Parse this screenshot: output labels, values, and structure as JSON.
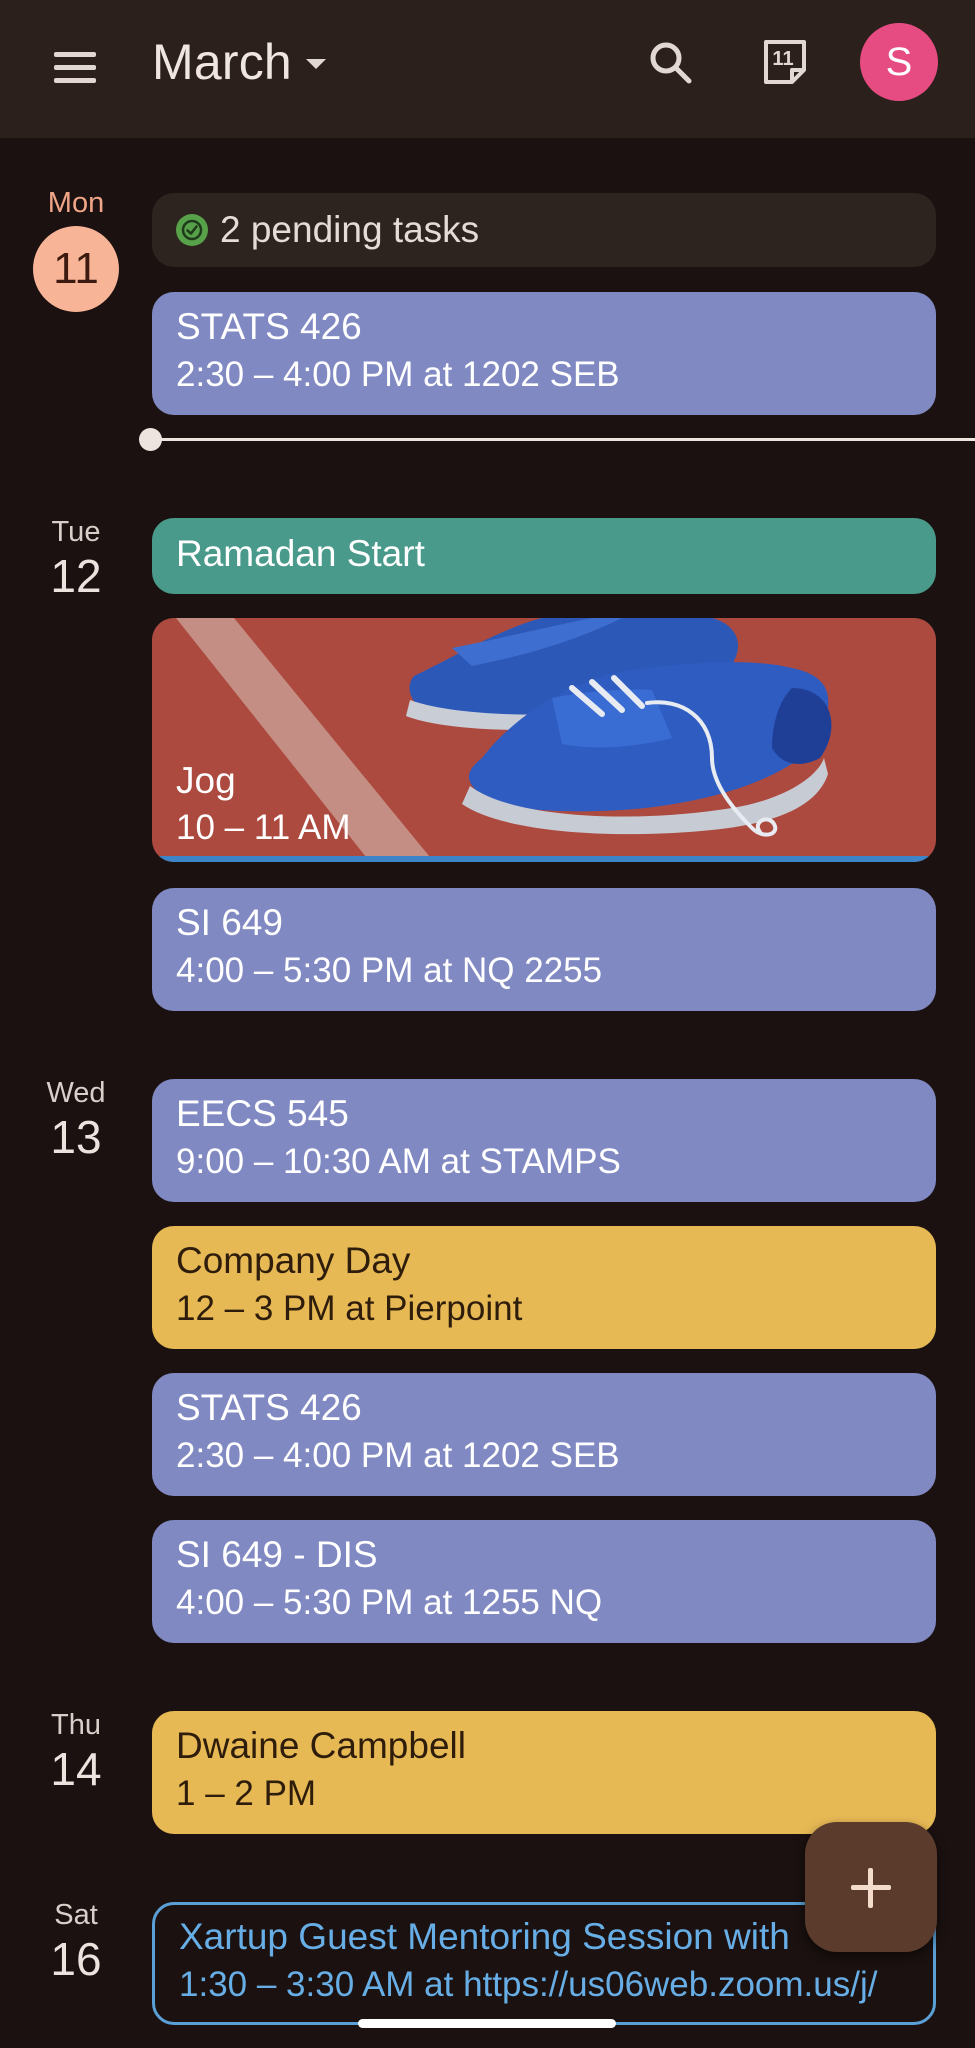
{
  "header": {
    "month": "March",
    "today_num": "11",
    "avatar_letter": "S"
  },
  "days": [
    {
      "dow": "Mon",
      "num": "11",
      "today": true,
      "tasks": "2 pending tasks",
      "events": [
        {
          "title": "STATS 426",
          "detail": "2:30 – 4:00 PM at 1202 SEB",
          "color": "#8089c2"
        }
      ]
    },
    {
      "dow": "Tue",
      "num": "12",
      "events": [
        {
          "title": "Ramadan Start",
          "detail": "",
          "color": "#4a9a8c"
        },
        {
          "title": "Jog",
          "detail": "10 – 11 AM",
          "color": "#ad4a3f"
        },
        {
          "title": "SI 649",
          "detail": "4:00 – 5:30 PM at NQ 2255",
          "color": "#8089c2"
        }
      ]
    },
    {
      "dow": "Wed",
      "num": "13",
      "events": [
        {
          "title": "EECS 545",
          "detail": "9:00 – 10:30 AM at STAMPS",
          "color": "#8089c2"
        },
        {
          "title": "Company Day",
          "detail": "12 – 3 PM at Pierpoint",
          "color": "#e7b955"
        },
        {
          "title": "STATS 426",
          "detail": "2:30 – 4:00 PM at 1202 SEB",
          "color": "#8089c2"
        },
        {
          "title": "SI 649 - DIS",
          "detail": "4:00 – 5:30 PM at 1255 NQ",
          "color": "#8089c2"
        }
      ]
    },
    {
      "dow": "Thu",
      "num": "14",
      "events": [
        {
          "title": "Dwaine Campbell",
          "detail": "1 – 2 PM",
          "color": "#e7b955"
        }
      ]
    },
    {
      "dow": "Sat",
      "num": "16",
      "events": [
        {
          "title": "Xartup Guest Mentoring Session with",
          "detail": "1:30 – 3:30 AM at https://us06web.zoom.us/j/",
          "color": "#5a9fd6"
        }
      ]
    }
  ],
  "icons": {
    "menu": "menu-icon",
    "search": "search-icon",
    "today": "calendar-today-icon",
    "task": "task-check-icon",
    "fab": "plus-icon"
  }
}
